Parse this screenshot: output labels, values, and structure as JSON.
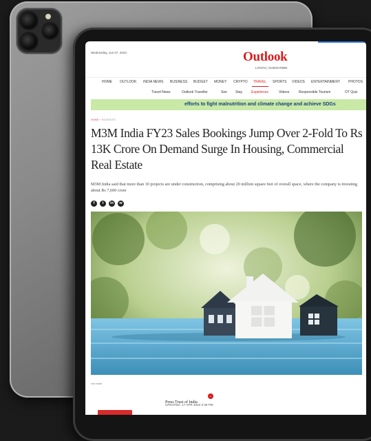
{
  "site": {
    "date": "Wednesday, Jun 07, 2023",
    "logo": "Outlook",
    "auth": "LOGIN | SUBSCRIBE"
  },
  "nav": {
    "items": [
      "HOME",
      "OUTLOOK",
      "INDIA NEWS",
      "BUSINESS",
      "BUDGET",
      "MONEY",
      "CRYPTO",
      "TRAVEL",
      "SPORTS",
      "VIDEOS",
      "ENTERTAINMENT",
      "PHOTOS"
    ],
    "active": "TRAVEL"
  },
  "subnav": {
    "items": [
      "Travel News",
      "Outlook Traveller",
      "See",
      "Stay",
      "Experience",
      "Videos",
      "Responsible Tourism",
      "OT Quiz"
    ],
    "active": "Experience"
  },
  "banner": {
    "text": "efforts to fight malnutrition and climate change and achieve SDGs"
  },
  "breadcrumb": {
    "home": "HOME",
    "separator": "»",
    "section": "BUSINESS"
  },
  "article": {
    "headline": "M3M India FY23 Sales Bookings Jump Over 2-Fold To Rs 13K Crore On Demand Surge In Housing, Commercial Real Estate",
    "summary": "M3M India said that more than 10 projects are under construction, comprising about 20 million square feet of overall space, where the company is investing about Rs 7,600 crore",
    "image_credit": "real estate",
    "author": "Press Trust of India",
    "updated": "UPDATED: 17 APR 2023 3:48 PM"
  },
  "socials": [
    {
      "icon": "facebook-icon",
      "glyph": "f"
    },
    {
      "icon": "twitter-icon",
      "glyph": "t"
    },
    {
      "icon": "linkedin-icon",
      "glyph": "in"
    },
    {
      "icon": "whatsapp-icon",
      "glyph": "w"
    }
  ],
  "colors": {
    "brand_red": "#d81d1d",
    "banner_green": "#c9e9a7",
    "banner_text": "#1a3f7a"
  }
}
